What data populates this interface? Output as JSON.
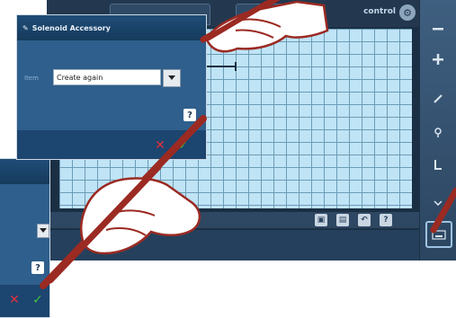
{
  "canvas": {
    "mode_label": "control",
    "mode_icon": "gear-icon",
    "bottom_buttons": [
      "copy-icon",
      "paste-icon",
      "undo-icon",
      "?"
    ]
  },
  "right_toolbar": {
    "items": [
      "minus-icon",
      "plus-icon",
      "pen-icon",
      "select-icon",
      "pointer-icon",
      "tool-icon",
      "keyboard-icon"
    ]
  },
  "dialog_front": {
    "title": "Solenoid Accessory",
    "title_icon": "pencil-icon",
    "item_label": "Item",
    "select_value": "Create again",
    "help": "?",
    "cancel": "✕",
    "ok": "✓"
  },
  "dialog_back": {
    "help": "?",
    "cancel": "✕",
    "ok": "✓"
  },
  "colors": {
    "dialog_bg": "#2f5f8c",
    "grid_bg": "#bfe4f6",
    "cancel": "#e0303a",
    "ok": "#3ec23e",
    "hand_stroke": "#9b2a22"
  }
}
